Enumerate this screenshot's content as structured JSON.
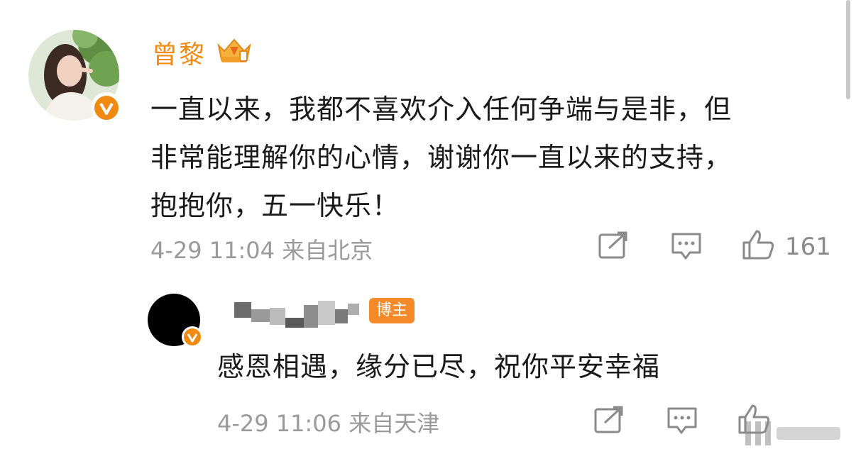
{
  "main_comment": {
    "username": "曾黎",
    "content_lines": [
      "一直以来，我都不喜欢介入任何争端与是非，但",
      "非常能理解你的心情，谢谢你一直以来的支持，",
      "抱抱你，五一快乐！"
    ],
    "time": "4-29 11:04",
    "location": "来自北京",
    "like_count": "161"
  },
  "reply": {
    "badge_label": "博主",
    "content": "感恩相遇，缘分已尽，祝你平安幸福",
    "time": "4-29 11:06",
    "location": "来自天津"
  },
  "icons": [
    "share-icon",
    "comment-icon",
    "like-icon",
    "verified-icon",
    "crown-icon"
  ],
  "colors": {
    "username": "#f08a12",
    "verified": "#f08a12",
    "meta_text": "#9a9a9a",
    "blogger_tag": "#f58a2a"
  }
}
